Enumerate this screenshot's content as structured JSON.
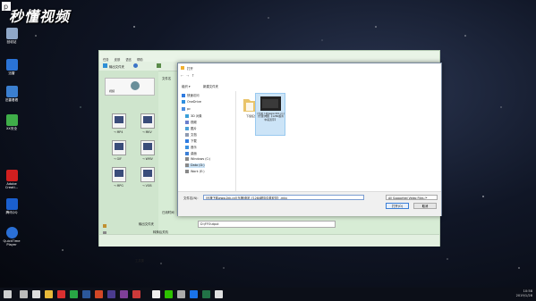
{
  "watermark": {
    "text": "秒懂视频"
  },
  "desktop_icons": [
    {
      "label": "回收站",
      "color": "#8fa7c8"
    },
    {
      "label": "迅雷",
      "color": "#2a73d6"
    },
    {
      "label": "迅雷看看",
      "color": "#3b7fd0"
    },
    {
      "label": "XX安全",
      "color": "#3fae49"
    },
    {
      "label": "Adobe Creati...",
      "color": "#d11f1f"
    },
    {
      "label": "腾讯QQ",
      "color": "#1a5fcf"
    },
    {
      "label": "QuickTime Player",
      "color": "#2a6fd6"
    }
  ],
  "app_window": {
    "toolbar_label": "输出文件夹",
    "menu_items": [
      "任务",
      "皮肤",
      "语言",
      "帮助"
    ],
    "side_label": "视频",
    "formats": [
      {
        "label": "→ MP4"
      },
      {
        "label": "→ MKV"
      },
      {
        "label": "→ GIF"
      },
      {
        "label": "→ WMV"
      },
      {
        "label": "→ MPG"
      },
      {
        "label": "→ VOB"
      }
    ],
    "file_label": "文件名",
    "output_label": "输出文件夹",
    "output_value": "D:\\FFOutput",
    "status_left": "已用时间",
    "status_mid": "转换后关机",
    "bottom_label": "工具集"
  },
  "dialog": {
    "title": "打开",
    "breadcrumb": [
      "pc",
      "Data (D:)",
      "迅雷下载"
    ],
    "search_placeholder": "搜索 迅雷下载",
    "organize": "组织 ▾",
    "new_folder": "新建文件夹",
    "tree": [
      {
        "label": "快速访问",
        "color": "#2f7be0"
      },
      {
        "label": "OneDrive",
        "color": "#2f8fe0"
      },
      {
        "label": "pc",
        "color": "#4a8de0"
      },
      {
        "label": "3D 对象",
        "color": "#3a9fd8"
      },
      {
        "label": "视频",
        "color": "#6b7fcc"
      },
      {
        "label": "图片",
        "color": "#4aa0d8"
      },
      {
        "label": "文档",
        "color": "#8f9ab0"
      },
      {
        "label": "下载",
        "color": "#2f7be0"
      },
      {
        "label": "音乐",
        "color": "#3a90e0"
      },
      {
        "label": "桌面",
        "color": "#3c7fd6"
      },
      {
        "label": "Windows (C:)",
        "color": "#888888"
      },
      {
        "label": "Data (D:)",
        "color": "#888888"
      },
      {
        "label": "Work (E:)",
        "color": "#888888"
      }
    ],
    "files": [
      {
        "label": "下载任务",
        "kind": "folder"
      },
      {
        "label": "[乐援下载www.2kk.cn][乐援]电影【1280超清中英双字】",
        "kind": "video",
        "selected": true
      }
    ],
    "filename_label": "文件名(N):",
    "filename_value": "[乐援下载www.2kk.cn][乐援]电影【1280超清中英双字】.mkv",
    "filetype_value": "All Supported Video Files (*",
    "open_button": "打开(O)",
    "cancel_button": "取消"
  },
  "taskbar": {
    "time": "10:58",
    "date": "2019/1/28"
  }
}
